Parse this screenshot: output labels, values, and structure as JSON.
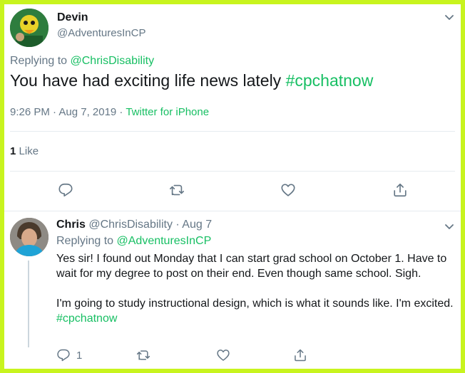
{
  "main_tweet": {
    "author_name": "Devin",
    "author_handle": "@AdventuresInCP",
    "replying_prefix": "Replying to",
    "replying_to": "@ChrisDisability",
    "text_plain": "You have had exciting life news lately",
    "hashtag": "#cpchatnow",
    "timestamp": "9:26 PM · Aug 7, 2019 ·",
    "source": "Twitter for iPhone",
    "like_count": "1",
    "like_label": "Like"
  },
  "reply_tweet": {
    "author_name": "Chris",
    "author_handle": "@ChrisDisability",
    "date": "· Aug 7",
    "replying_prefix": "Replying to",
    "replying_to": "@AdventuresInCP",
    "paragraph1": "Yes sir! I found out Monday that I can start grad school on October 1. Have to wait for my degree to post on their end. Even though same school. Sigh.",
    "paragraph2": "I'm going to study instructional design, which is what it sounds like. I'm excited.",
    "hashtag": "#cpchatnow",
    "reply_count": "1"
  },
  "icons": [
    "chevron-down-icon",
    "reply-icon",
    "retweet-icon",
    "like-icon",
    "share-icon"
  ],
  "colors": {
    "frame_border": "#c8f41e",
    "link": "#17bf63",
    "secondary_text": "#657786",
    "primary_text": "#14171a",
    "divider": "#e6ecf0"
  }
}
